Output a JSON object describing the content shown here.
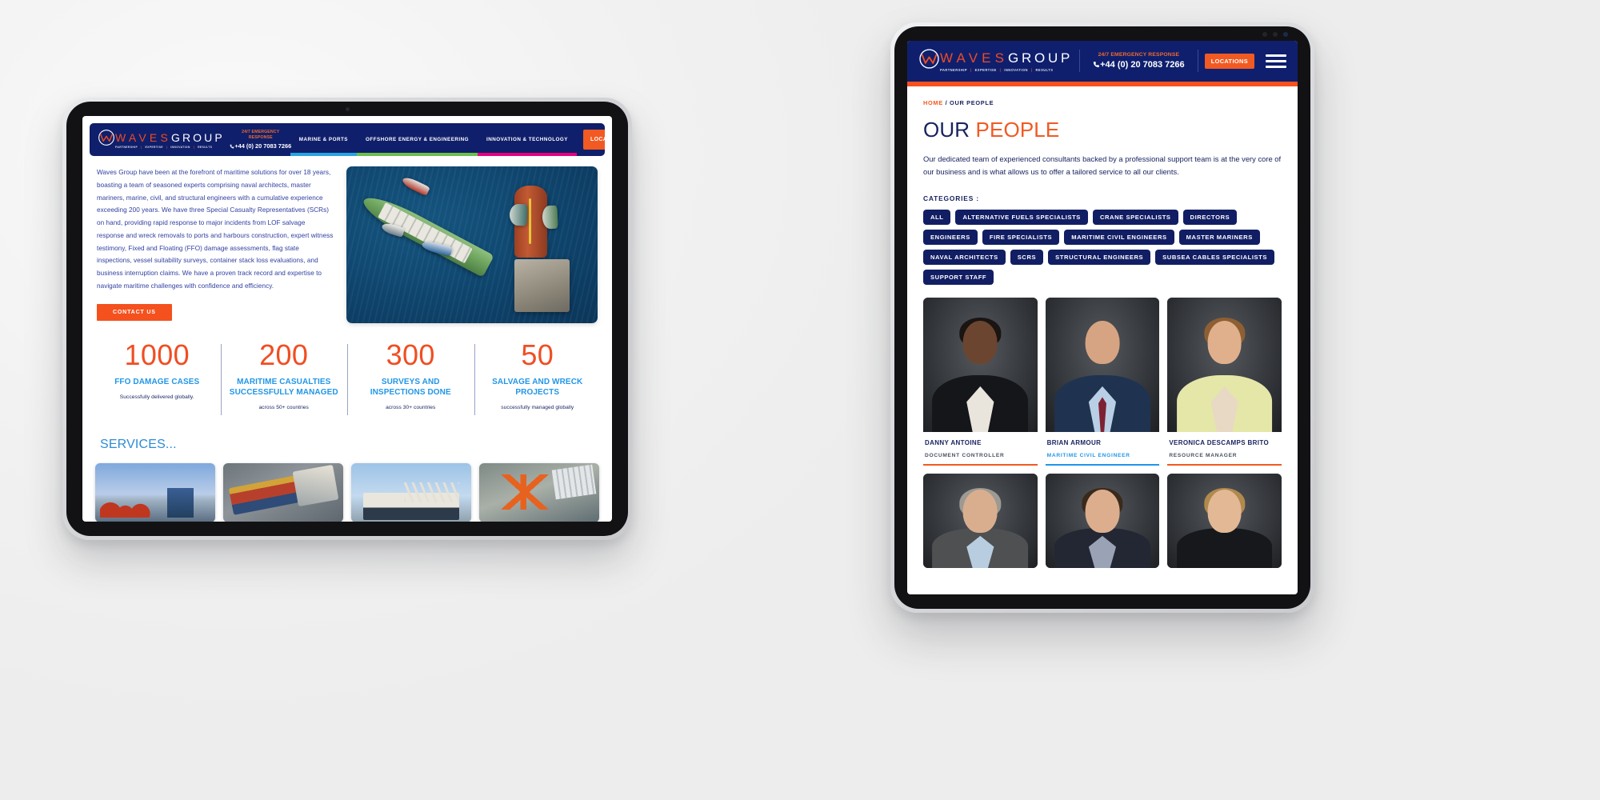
{
  "brand": {
    "name_part1": "WAVES",
    "name_part2": "GROUP",
    "tagline": [
      "PARTNERSHIP",
      "EXPERTISE",
      "INNOVATION",
      "RESULTS"
    ],
    "tagline_sep": "|",
    "colors": {
      "navy": "#101f6b",
      "orange": "#f15a22",
      "red_orange": "#f04e23",
      "light_blue": "#2196e8",
      "nav_blue": "#29a3e0",
      "nav_green": "#6cc04a",
      "nav_pink": "#e6007e",
      "deep_navy": "#17225f"
    }
  },
  "left_tablet": {
    "nav": {
      "emergency_label": "24/7 EMERGENCY RESPONSE",
      "phone": "+44 (0) 20 7083 7266",
      "phone_icon": "phone-icon",
      "items": [
        {
          "label": "MARINE & PORTS",
          "underline": "#29a3e0"
        },
        {
          "label": "OFFSHORE ENERGY & ENGINEERING",
          "underline": "#6cc04a"
        },
        {
          "label": "INNOVATION & TECHNOLOGY",
          "underline": "#e6007e"
        }
      ],
      "locations_label": "LOCATIONS",
      "menu_icon": "hamburger-menu-icon"
    },
    "intro": {
      "paragraph": "Waves Group have been at the forefront of maritime solutions for over 18 years, boasting a team of seasoned experts comprising naval architects, master mariners, marine, civil, and structural engineers with a cumulative experience exceeding 200 years. We have three Special Casualty Representatives (SCRs) on hand,  providing rapid response to major incidents from LOF salvage response and wreck removals to ports and harbours construction, expert witness testimony, Fixed and Floating (FFO) damage assessments, flag state inspections, vessel suitability surveys, container stack loss evaluations, and business interruption claims. We have a proven track record and expertise to navigate maritime challenges with confidence and efficiency.",
      "cta_label": "CONTACT US"
    },
    "hero_image_alt": "aerial-view-of-ship-salvage-operation",
    "stats": [
      {
        "number": "1000",
        "label": "FFO DAMAGE CASES",
        "sub": "Successfully delivered globally."
      },
      {
        "number": "200",
        "label": "MARITIME CASUALTIES SUCCESSFULLY MANAGED",
        "sub": "across 50+ countries"
      },
      {
        "number": "300",
        "label": "SURVEYS AND INSPECTIONS DONE",
        "sub": "across 30+ countries"
      },
      {
        "number": "50",
        "label": "SALVAGE AND WRECK PROJECTS",
        "sub": "successfully managed globally"
      }
    ],
    "services_heading": "SERVICES...",
    "service_cards": [
      {
        "alt": "lng-terminal-tanks-image"
      },
      {
        "alt": "barge-cargo-vessel-aerial-image"
      },
      {
        "alt": "vessel-superstructure-image"
      },
      {
        "alt": "orange-crane-port-image"
      }
    ]
  },
  "right_tablet": {
    "nav": {
      "emergency_label": "24/7 EMERGENCY RESPONSE",
      "phone": "+44 (0) 20 7083 7266",
      "phone_icon": "phone-icon",
      "locations_label": "LOCATIONS",
      "menu_icon": "hamburger-menu-icon"
    },
    "breadcrumb": {
      "home": "HOME",
      "separator": "/",
      "current": "OUR PEOPLE"
    },
    "title": {
      "part1": "OUR",
      "part2": "PEOPLE"
    },
    "lede": "Our dedicated team of experienced consultants backed by a professional support team is at the very core of our business and is what allows us to offer a tailored service to all our clients.",
    "categories_label": "CATEGORIES :",
    "categories": [
      "ALL",
      "ALTERNATIVE FUELS SPECIALISTS",
      "CRANE SPECIALISTS",
      "DIRECTORS",
      "ENGINEERS",
      "FIRE SPECIALISTS",
      "MARITIME CIVIL ENGINEERS",
      "MASTER MARINERS",
      "NAVAL ARCHITECTS",
      "SCRS",
      "STRUCTURAL ENGINEERS",
      "SUBSEA CABLES SPECIALISTS",
      "SUPPORT STAFF"
    ],
    "people": [
      {
        "name": "DANNY ANTOINE",
        "role": "DOCUMENT CONTROLLER",
        "accent": "orange"
      },
      {
        "name": "BRIAN ARMOUR",
        "role": "MARITIME CIVIL ENGINEER",
        "accent": "blue"
      },
      {
        "name": "VERONICA DESCAMPS BRITO",
        "role": "RESOURCE MANAGER",
        "accent": "orange"
      }
    ]
  }
}
